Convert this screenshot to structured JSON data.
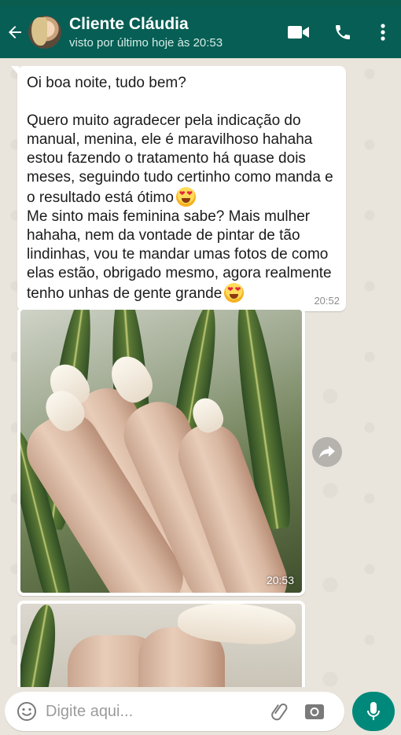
{
  "header": {
    "contact_name": "Cliente Cláudia",
    "last_seen": "visto por último hoje às 20:53",
    "icons": [
      "back-arrow-icon",
      "video-call-icon",
      "voice-call-icon",
      "more-options-icon"
    ]
  },
  "messages": [
    {
      "type": "text",
      "lines": [
        "Oi boa noite, tudo bem?",
        "",
        "Quero muito agradecer pela indicação do",
        "manual, menina, ele é maravilhoso hahaha",
        "estou fazendo o tratamento há quase dois",
        "meses, seguindo tudo certinho como manda e",
        "o resultado está ótimo",
        "Me sinto mais feminina sabe? Mais mulher",
        "hahaha, nem da vontade de pintar de tão",
        "lindinhas, vou te mandar umas fotos de como",
        "elas estão, obrigado mesmo, agora realmente",
        "tenho unhas de gente grande"
      ],
      "emoji": "heart-eyes-emoji",
      "time": "20:52"
    },
    {
      "type": "image",
      "description_icon": "photo",
      "time": "20:53"
    },
    {
      "type": "image",
      "description_icon": "photo",
      "time": ""
    }
  ],
  "composer": {
    "placeholder": "Digite aqui...",
    "icons": [
      "emoji-icon",
      "attach-icon",
      "camera-icon",
      "mic-icon"
    ]
  },
  "colors": {
    "header": "#075e54",
    "accent": "#00897b",
    "chat_background": "#e9e4dc",
    "bubble": "#ffffff"
  }
}
